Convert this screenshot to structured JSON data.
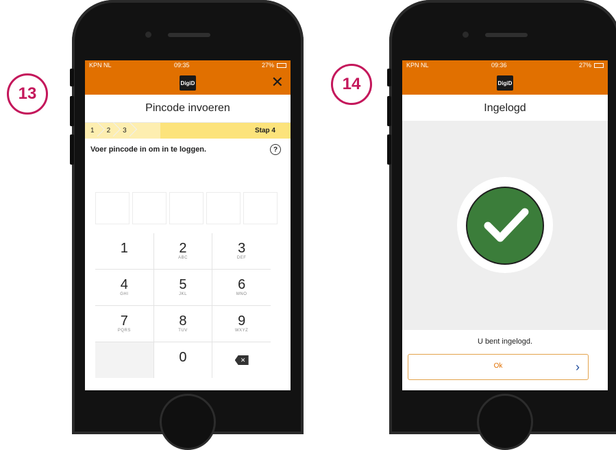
{
  "badges": {
    "left": "13",
    "right": "14"
  },
  "left_phone": {
    "status": {
      "carrier": "KPN NL",
      "time": "09:35",
      "battery": "27%"
    },
    "logo": "DigiD",
    "close_icon": "close-icon",
    "title": "Pincode invoeren",
    "steps": [
      "1",
      "2",
      "3"
    ],
    "current_step": "Stap 4",
    "instruction": "Voer pincode in om in te loggen.",
    "help_symbol": "?",
    "keypad": [
      {
        "digit": "1",
        "letters": ""
      },
      {
        "digit": "2",
        "letters": "ABC"
      },
      {
        "digit": "3",
        "letters": "DEF"
      },
      {
        "digit": "4",
        "letters": "GHI"
      },
      {
        "digit": "5",
        "letters": "JKL"
      },
      {
        "digit": "6",
        "letters": "MNO"
      },
      {
        "digit": "7",
        "letters": "PQRS"
      },
      {
        "digit": "8",
        "letters": "TUV"
      },
      {
        "digit": "9",
        "letters": "WXYZ"
      }
    ],
    "zero": "0"
  },
  "right_phone": {
    "status": {
      "carrier": "KPN NL",
      "time": "09:36",
      "battery": "27%"
    },
    "logo": "DigiD",
    "title": "Ingelogd",
    "message": "U bent ingelogd.",
    "ok_label": "Ok"
  },
  "colors": {
    "brand_orange": "#e17000",
    "step_yellow": "#fce37b",
    "check_green": "#3b7d3a",
    "badge_magenta": "#c4175b"
  }
}
